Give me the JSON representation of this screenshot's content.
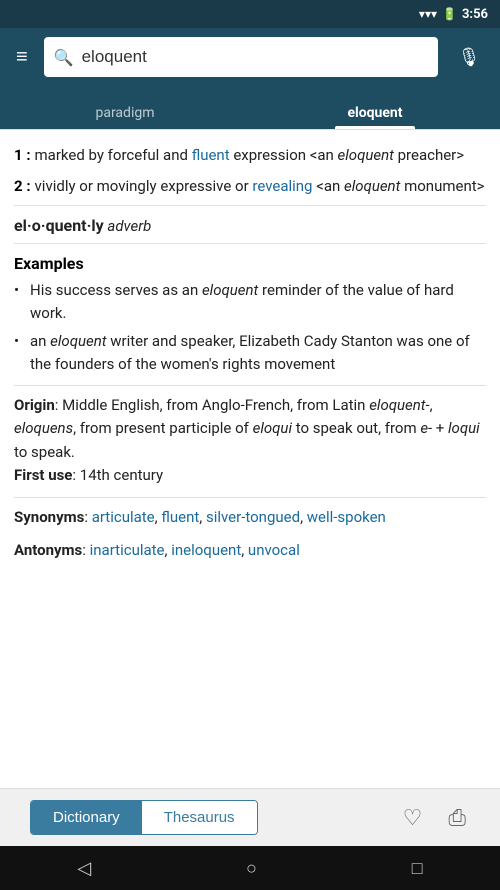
{
  "statusBar": {
    "time": "3:56",
    "signalIcon": "▾",
    "batteryIcon": "▮"
  },
  "header": {
    "menuIcon": "≡",
    "searchValue": "eloquent",
    "searchPlaceholder": "Search",
    "micIcon": "🎙"
  },
  "tabs": [
    {
      "id": "paradigm",
      "label": "paradigm",
      "active": false
    },
    {
      "id": "eloquent",
      "label": "eloquent",
      "active": true
    }
  ],
  "content": {
    "definitions": [
      {
        "number": "1",
        "text": " marked by forceful and ",
        "link1": "fluent",
        "text2": " expression <an ",
        "italic1": "eloquent",
        "text3": " preacher>"
      },
      {
        "number": "2",
        "text": " vividly or movingly expressive or ",
        "link1": "revealing",
        "text2": " <an ",
        "italic1": "eloquent",
        "text3": " monument>"
      }
    ],
    "wordForm": {
      "word": "el·o·quent·ly",
      "pos": "adverb"
    },
    "examplesTitle": "Examples",
    "examples": [
      {
        "text": "His success serves as an ",
        "italic": "eloquent",
        "text2": " reminder of the value of hard work."
      },
      {
        "text": "an ",
        "italic": "eloquent",
        "text2": " writer and speaker, Elizabeth Cady Stanton was one of the founders of the women's rights movement"
      }
    ],
    "origin": {
      "label": "Origin",
      "text": ": Middle English, from Anglo-French, from Latin ",
      "italic1": "eloquent-",
      "text2": ", ",
      "italic2": "eloquens",
      "text3": ", from present participle of ",
      "italic3": "eloqui",
      "text4": " to speak out, from ",
      "italic4": "e-",
      "text5": " + ",
      "italic5": "loqui",
      "text6": " to speak."
    },
    "firstUse": {
      "label": "First use",
      "text": ": 14th century"
    },
    "synonyms": {
      "label": "Synonyms",
      "links": [
        "articulate",
        "fluent",
        "silver-tongued",
        "well-spoken"
      ]
    },
    "antonyms": {
      "label": "Antonyms",
      "links": [
        "inarticulate",
        "ineloquent",
        "unvocal"
      ]
    }
  },
  "bottomTabs": {
    "dictionary": "Dictionary",
    "thesaurus": "Thesaurus"
  },
  "bottomActions": {
    "favoriteIcon": "♡",
    "shareIcon": "⎙"
  },
  "androidNav": {
    "backIcon": "◁",
    "homeIcon": "○",
    "recentIcon": "□"
  }
}
